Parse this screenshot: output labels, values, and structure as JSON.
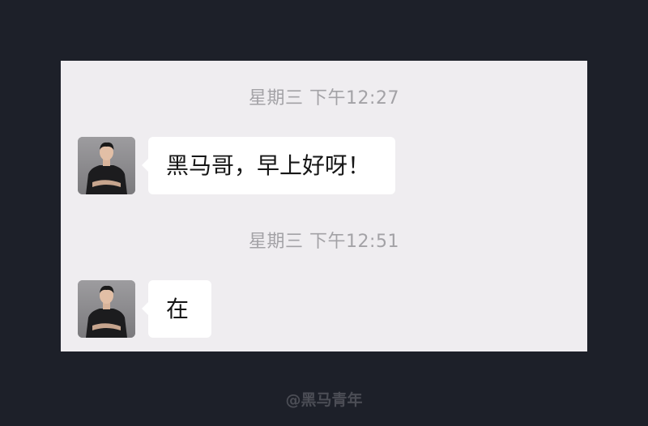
{
  "messages": [
    {
      "timestamp": "星期三 下午12:27",
      "text": "黑马哥，早上好呀！",
      "sender_avatar": "person-photo-avatar"
    },
    {
      "timestamp": "星期三 下午12:51",
      "text": "在",
      "sender_avatar": "person-photo-avatar"
    }
  ],
  "watermark": "@黑马青年",
  "colors": {
    "background": "#1d2029",
    "panel": "#efedf0",
    "bubble": "#ffffff",
    "timestamp_text": "#a3a2a6",
    "message_text": "#161616",
    "watermark_text": "#4b4d55"
  }
}
